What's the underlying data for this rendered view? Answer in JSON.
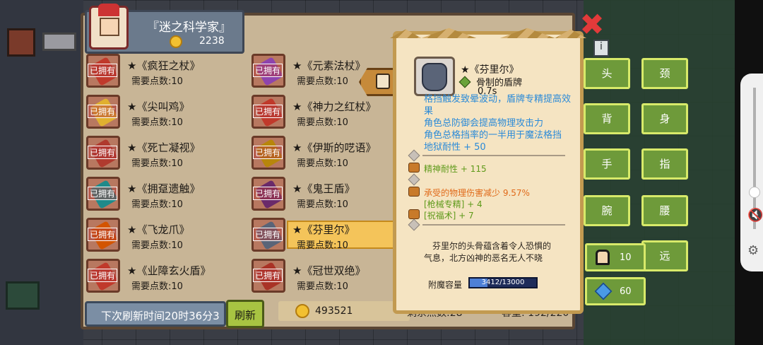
{
  "profile": {
    "title": "『迷之科学家』",
    "points": "2238"
  },
  "items": [
    {
      "name": "★《疯狂之杖》",
      "cost": "需要点数:10",
      "owned": "已拥有",
      "color": "#c0392b"
    },
    {
      "name": "★《元素法杖》",
      "cost": "需要点数:10",
      "owned": "已拥有",
      "color": "#8e44ad"
    },
    {
      "name": "★《尖叫鸡》",
      "cost": "需要点数:10",
      "owned": "已拥有",
      "color": "#e0b030"
    },
    {
      "name": "★《神力之红杖》",
      "cost": "需要点数:10",
      "owned": "已拥有",
      "color": "#c0392b"
    },
    {
      "name": "★《死亡凝视》",
      "cost": "需要点数:10",
      "owned": "已拥有",
      "color": "#b03a2e"
    },
    {
      "name": "★《伊斯的呓语》",
      "cost": "需要点数:10",
      "owned": "已拥有",
      "color": "#b8860b"
    },
    {
      "name": "★《拥趸遗触》",
      "cost": "需要点数:10",
      "owned": "已拥有",
      "color": "#1f8a8a"
    },
    {
      "name": "★《鬼王盾》",
      "cost": "需要点数:10",
      "owned": "已拥有",
      "color": "#6a2a6a"
    },
    {
      "name": "★《飞龙爪》",
      "cost": "需要点数:10",
      "owned": "已拥有",
      "color": "#d35400"
    },
    {
      "name": "★《芬里尔》",
      "cost": "需要点数:10",
      "owned": "已拥有",
      "color": "#5a6478",
      "selected": true
    },
    {
      "name": "★《业障玄火盾》",
      "cost": "需要点数:10",
      "owned": "已拥有",
      "color": "#c0392b"
    },
    {
      "name": "★《冠世双绝》",
      "cost": "需要点数:10",
      "owned": "已拥有",
      "color": "#a93226"
    }
  ],
  "bottom": {
    "refresh_timer": "下次刷新时间20时36分3",
    "refresh_button": "刷新",
    "gold": "493521",
    "points_left": "剩余点数:28",
    "capacity": "容量: 192/220"
  },
  "tooltip": {
    "name": "★《芬里尔》",
    "type": "骨制的盾牌",
    "time": "0.7s",
    "desc": [
      "格挡触发致晕波动，盾牌专精提高效",
      "果",
      "角色总防御会提高物理攻击力",
      "角色总格挡率的一半用于魔法格挡",
      "地狱耐性 + 50"
    ],
    "stat1": "精神耐性 + 115",
    "stat2": "承受的物理伤害减少 9.57%",
    "stat3": "[枪械专精] + 4",
    "stat4": "[祝福术] + 7",
    "flavor": "芬里尔的头骨蕴含着令人恐惧的气息，北方凶神的恶名无人不晓",
    "enchant_label": "附魔容量",
    "enchant_value": "3412/13000",
    "enchant_ratio": 0.2625
  },
  "slots": [
    "头",
    "颈",
    "背",
    "身",
    "手",
    "指",
    "腕",
    "腰",
    "远"
  ],
  "currency": {
    "characters": "10",
    "gems": "60"
  },
  "icons": {
    "close": "✖",
    "info": "i"
  }
}
